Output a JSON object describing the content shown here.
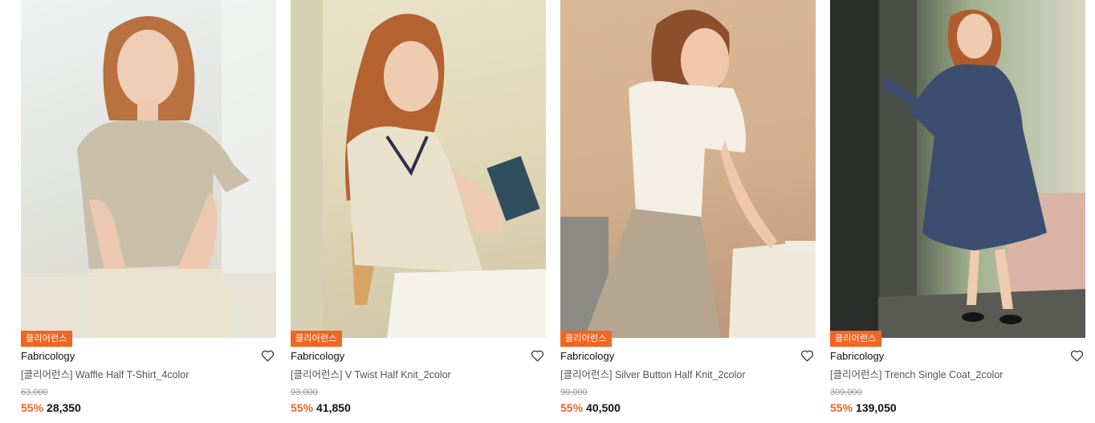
{
  "products": [
    {
      "badge": "클리어런스",
      "brand": "Fabricology",
      "title": "[클리어런스] Waffle Half T-Shirt_4color",
      "original_price": "63,000",
      "discount": "55%",
      "sale_price": "28,350",
      "photo": "model-waffle-tshirt"
    },
    {
      "badge": "클리어런스",
      "brand": "Fabricology",
      "title": "[클리어런스] V Twist Half Knit_2color",
      "original_price": "93,000",
      "discount": "55%",
      "sale_price": "41,850",
      "photo": "model-v-twist-knit"
    },
    {
      "badge": "클리어런스",
      "brand": "Fabricology",
      "title": "[클리어런스] Silver Button Half Knit_2color",
      "original_price": "90,000",
      "discount": "55%",
      "sale_price": "40,500",
      "photo": "model-silver-button-knit"
    },
    {
      "badge": "클리어런스",
      "brand": "Fabricology",
      "title": "[클리어런스] Trench Single Coat_2color",
      "original_price": "309,000",
      "discount": "55%",
      "sale_price": "139,050",
      "photo": "model-trench-coat"
    }
  ],
  "colors": {
    "accent": "#f26522",
    "text": "#111111",
    "muted": "#999999"
  },
  "icons": {
    "wishlist": "heart-outline-icon"
  }
}
